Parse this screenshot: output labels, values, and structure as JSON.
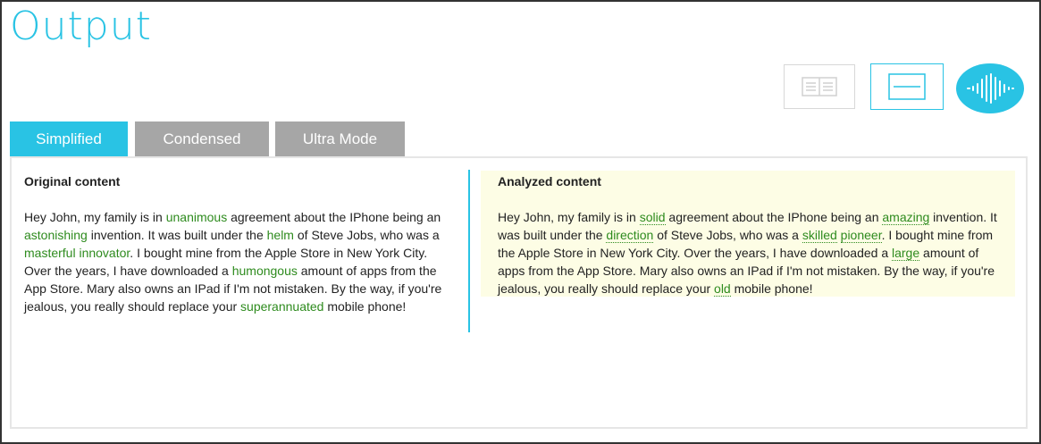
{
  "header": {
    "title": "Output"
  },
  "view_controls": {
    "split_view_icon": "split-columns-icon",
    "single_view_icon": "single-panel-icon",
    "audio_icon": "audio-waveform-icon",
    "accent": "#29c3e4"
  },
  "tabs": [
    {
      "label": "Simplified",
      "active": true
    },
    {
      "label": "Condensed",
      "active": false
    },
    {
      "label": "Ultra Mode",
      "active": false
    }
  ],
  "original": {
    "heading": "Original content",
    "t1": "Hey John, my family is in ",
    "w1": "unanimous",
    "t2": " agreement about the IPhone being an ",
    "w2": "astonishing",
    "t3": " invention. It was built under the ",
    "w3": "helm",
    "t4": " of Steve Jobs, who was a ",
    "w4": "masterful innovator",
    "t5": ". I bought mine from the Apple Store in New York City. Over the years, I have downloaded a ",
    "w5": "humongous",
    "t6": " amount of apps from the App Store. Mary also owns an IPad if I'm not mistaken. By the way, if you're jealous, you really should replace your ",
    "w6": "superannuated",
    "t7": " mobile phone!"
  },
  "analyzed": {
    "heading": "Analyzed content",
    "t1": "Hey John, my family is in ",
    "w1": "solid",
    "t2": " agreement about the IPhone being an ",
    "w2": "amazing",
    "t3": " invention. It was built under the ",
    "w3": "direction",
    "t4": " of Steve Jobs, who was a ",
    "w4a": "skilled",
    "w4b": "pioneer",
    "t5": ". I bought mine from the Apple Store in New York City. Over the years, I have downloaded a ",
    "w5": "large",
    "t6": " amount of apps from the App Store. Mary also owns an IPad if I'm not mistaken. By the way, if you're jealous, you really should replace your ",
    "w6": "old",
    "t7": " mobile phone!"
  },
  "colors": {
    "highlight_word": "#2e8b1e",
    "analyzed_background": "#fdfde5",
    "inactive_tab": "#a6a6a6"
  }
}
